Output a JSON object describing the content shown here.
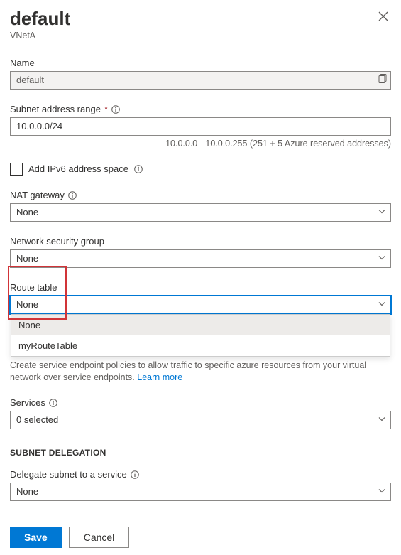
{
  "header": {
    "title": "default",
    "breadcrumb": "VNetA"
  },
  "fields": {
    "name": {
      "label": "Name",
      "value": "default"
    },
    "subnetRange": {
      "label": "Subnet address range",
      "required": "*",
      "value": "10.0.0.0/24",
      "hint": "10.0.0.0 - 10.0.0.255 (251 + 5 Azure reserved addresses)"
    },
    "addIpv6": {
      "label": "Add IPv6 address space"
    },
    "natGateway": {
      "label": "NAT gateway",
      "value": "None"
    },
    "nsg": {
      "label": "Network security group",
      "value": "None"
    },
    "routeTable": {
      "label": "Route table",
      "value": "None",
      "options": [
        "None",
        "myRouteTable"
      ]
    },
    "serviceEndpoints": {
      "helper": "Create service endpoint policies to allow traffic to specific azure resources from your virtual network over service endpoints. ",
      "learnMore": "Learn more"
    },
    "services": {
      "label": "Services",
      "value": "0 selected"
    },
    "delegation": {
      "sectionTitle": "SUBNET DELEGATION",
      "label": "Delegate subnet to a service",
      "value": "None"
    }
  },
  "footer": {
    "save": "Save",
    "cancel": "Cancel"
  }
}
